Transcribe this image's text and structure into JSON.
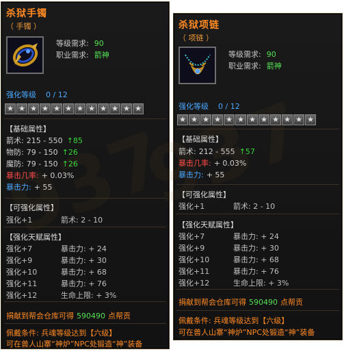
{
  "left": {
    "title": "杀狱手镯",
    "subtitle": "（ 手镯 ）",
    "req": [
      {
        "label": "等级需求:",
        "value": "90"
      },
      {
        "label": "职业需求:",
        "value": "箭神"
      }
    ],
    "enhance": {
      "label": "强化等级",
      "value": "0 / 12"
    },
    "stars": [
      "★",
      "★",
      "★",
      "★",
      "★",
      "★",
      "★",
      "★",
      "★",
      "★",
      "★",
      "★"
    ],
    "base_title": "【基础属性】",
    "base": [
      {
        "label": "箭术:",
        "value": "215 - 550",
        "up": "↑85",
        "style": ""
      },
      {
        "label": "物防:",
        "value": "79 - 150",
        "up": "↑26",
        "style": ""
      },
      {
        "label": "魔防:",
        "value": "79 - 150",
        "up": "↑26",
        "style": ""
      },
      {
        "label": "暴击几率:",
        "value": "+ 0.03%",
        "up": "",
        "style": "red"
      },
      {
        "label": "暴击力:",
        "value": "+ 55",
        "up": "",
        "style": "blue"
      }
    ],
    "enh_attr_title": "【可强化属性】",
    "enh_attr": [
      {
        "a": "强化+1",
        "b": "箭术: 2 - 10"
      }
    ],
    "talent_title": "【强化天赋属性】",
    "talent": [
      {
        "a": "强化+7",
        "b": "暴击力: + 24"
      },
      {
        "a": "强化+9",
        "b": "暴击力: + 30"
      },
      {
        "a": "强化+10",
        "b": "暴击力: + 68"
      },
      {
        "a": "强化+11",
        "b": "暴击力: + 76"
      },
      {
        "a": "强化+12",
        "b": "生命上限: + 3%"
      }
    ],
    "donate": {
      "before": "捐献到帮会仓库可得",
      "num": "590490",
      "after": "点帮贡"
    },
    "cond1": "佩戴条件: 兵魂等级达到【六级】",
    "cond2": "可在兽人山寨“神炉”NPC处锻造“神”装备"
  },
  "right": {
    "title": "杀狱项链",
    "subtitle": "（ 项链 ）",
    "req": [
      {
        "label": "等级需求:",
        "value": "90"
      },
      {
        "label": "职业需求:",
        "value": "箭神"
      }
    ],
    "enhance": {
      "label": "强化等级",
      "value": "0 / 12"
    },
    "stars": [
      "★",
      "★",
      "★",
      "★",
      "★",
      "★",
      "★",
      "★",
      "★",
      "★",
      "★",
      "★"
    ],
    "base_title": "【基础属性】",
    "base": [
      {
        "label": "箭术:",
        "value": "212 - 555",
        "up": "↑57",
        "style": ""
      },
      {
        "label": "暴击几率:",
        "value": "+ 0.03%",
        "up": "",
        "style": "red"
      },
      {
        "label": "暴击力:",
        "value": "+ 55",
        "up": "",
        "style": "blue"
      }
    ],
    "enh_attr_title": "【可强化属性】",
    "enh_attr": [
      {
        "a": "强化+1",
        "b": "箭术: 2 - 10"
      }
    ],
    "talent_title": "【强化天赋属性】",
    "talent": [
      {
        "a": "强化+7",
        "b": "暴击力: + 24"
      },
      {
        "a": "强化+9",
        "b": "暴击力: + 30"
      },
      {
        "a": "强化+10",
        "b": "暴击力: + 68"
      },
      {
        "a": "强化+11",
        "b": "暴击力: + 76"
      },
      {
        "a": "强化+12",
        "b": "生命上限: + 3%"
      }
    ],
    "donate": {
      "before": "捐献到帮会仓库可得",
      "num": "590490",
      "after": "点帮贡"
    },
    "cond1": "佩戴条件: 兵魂等级达到【六级】",
    "cond2": "可在兽人山寨“神炉”NPC处锻造“神”装备"
  },
  "icons": {
    "item1": "bracelet-icon",
    "item2": "necklace-icon",
    "star": "star-icon"
  }
}
